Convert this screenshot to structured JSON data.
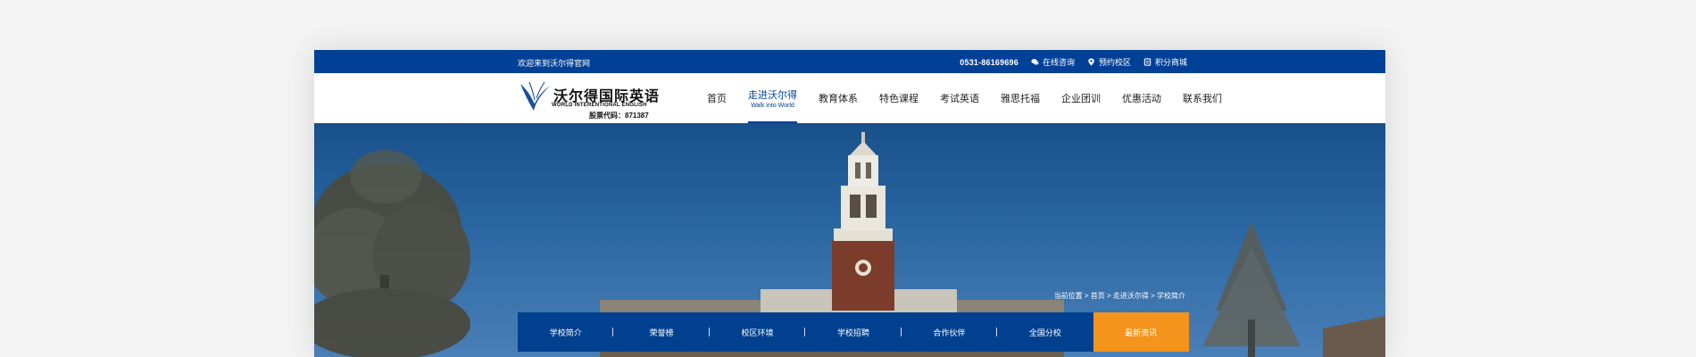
{
  "topbar": {
    "welcome": "欢迎来到沃尔得官网",
    "phone": "0531-86169696",
    "links": [
      {
        "label": "在线咨询",
        "icon": "chat-icon"
      },
      {
        "label": "预约校区",
        "icon": "location-pin-icon"
      },
      {
        "label": "积分商城",
        "icon": "cart-icon"
      }
    ]
  },
  "logo": {
    "brand": "沃尔得国际英语",
    "english": "WORLD INTERENTIONAL ENGLISH",
    "stock_code": "股票代码：871387"
  },
  "nav": {
    "items": [
      {
        "label": "首页"
      },
      {
        "label": "走进沃尔得",
        "sub": "Walk into World",
        "active": true
      },
      {
        "label": "教育体系"
      },
      {
        "label": "特色课程"
      },
      {
        "label": "考试英语"
      },
      {
        "label": "雅思托福"
      },
      {
        "label": "企业团训"
      },
      {
        "label": "优惠活动"
      },
      {
        "label": "联系我们"
      }
    ]
  },
  "breadcrumb": "当前位置 > 首页 > 走进沃尔得 > 学校简介",
  "subnav": {
    "items": [
      {
        "label": "学校简介"
      },
      {
        "label": "荣誉榜"
      },
      {
        "label": "校区环境"
      },
      {
        "label": "学校招聘"
      },
      {
        "label": "合作伙伴"
      },
      {
        "label": "全国分校"
      },
      {
        "label": "最新资讯",
        "active": true
      }
    ]
  },
  "colors": {
    "primary": "#004197",
    "accent": "#f4941d",
    "sky_top": "#18508a"
  }
}
